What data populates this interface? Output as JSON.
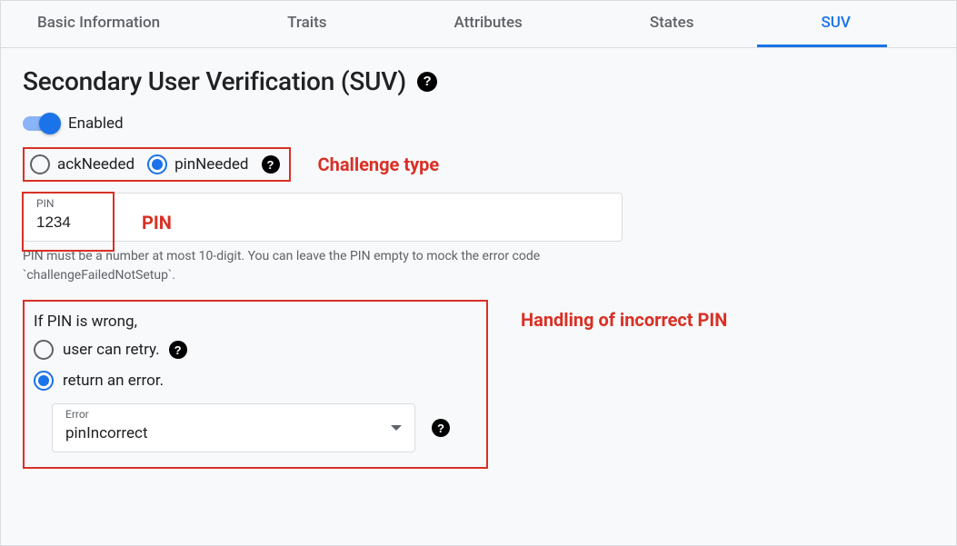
{
  "tabs": [
    {
      "label": "Basic Information",
      "active": false
    },
    {
      "label": "Traits",
      "active": false
    },
    {
      "label": "Attributes",
      "active": false
    },
    {
      "label": "States",
      "active": false
    },
    {
      "label": "SUV",
      "active": true
    }
  ],
  "page": {
    "title": "Secondary User Verification (SUV)"
  },
  "toggle": {
    "label": "Enabled",
    "value": true
  },
  "challenge_type": {
    "options": [
      {
        "label": "ackNeeded",
        "selected": false
      },
      {
        "label": "pinNeeded",
        "selected": true
      }
    ]
  },
  "pin_field": {
    "label": "PIN",
    "value": "1234",
    "helper": "PIN must be a number at most 10-digit. You can leave the PIN empty to mock the error code `challengeFailedNotSetup`."
  },
  "wrong_pin": {
    "title": "If PIN is wrong,",
    "options": [
      {
        "label": "user can retry.",
        "selected": false,
        "has_help": true
      },
      {
        "label": "return an error.",
        "selected": true,
        "has_help": false
      }
    ],
    "error_select": {
      "label": "Error",
      "value": "pinIncorrect"
    }
  },
  "annotations": {
    "challenge_type": "Challenge type",
    "pin": "PIN",
    "incorrect_pin": "Handling of incorrect PIN"
  }
}
